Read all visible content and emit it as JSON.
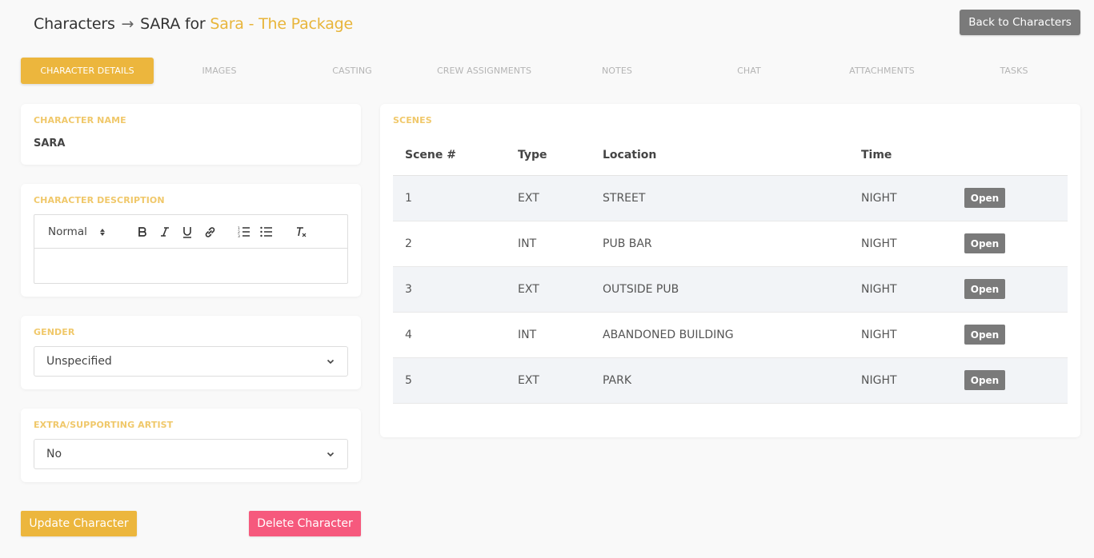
{
  "header": {
    "crumb_root": "Characters",
    "arrow": "→",
    "character": "SARA",
    "for_word": "for",
    "project": "Sara - The Package",
    "back_label": "Back to Characters"
  },
  "tabs": [
    {
      "label": "CHARACTER DETAILS",
      "active": true
    },
    {
      "label": "IMAGES"
    },
    {
      "label": "CASTING"
    },
    {
      "label": "CREW ASSIGNMENTS"
    },
    {
      "label": "NOTES"
    },
    {
      "label": "CHAT"
    },
    {
      "label": "ATTACHMENTS"
    },
    {
      "label": "TASKS"
    }
  ],
  "form": {
    "name_label": "CHARACTER NAME",
    "name_value": "SARA",
    "description_label": "CHARACTER DESCRIPTION",
    "editor_format": "Normal",
    "editor_tools": [
      "bold-icon",
      "italic-icon",
      "underline-icon",
      "link-icon",
      "ordered-list-icon",
      "bullet-list-icon",
      "clear-format-icon"
    ],
    "gender_label": "GENDER",
    "gender_value": "Unspecified",
    "extra_label": "EXTRA/SUPPORTING ARTIST",
    "extra_value": "No",
    "update_label": "Update Character",
    "delete_label": "Delete Character"
  },
  "scenes": {
    "label": "SCENES",
    "columns": [
      "Scene #",
      "Type",
      "Location",
      "Time",
      ""
    ],
    "open_label": "Open",
    "rows": [
      {
        "num": "1",
        "type": "EXT",
        "location": "STREET",
        "time": "NIGHT"
      },
      {
        "num": "2",
        "type": "INT",
        "location": "PUB BAR",
        "time": "NIGHT"
      },
      {
        "num": "3",
        "type": "EXT",
        "location": "OUTSIDE PUB",
        "time": "NIGHT"
      },
      {
        "num": "4",
        "type": "INT",
        "location": "ABANDONED BUILDING",
        "time": "NIGHT"
      },
      {
        "num": "5",
        "type": "EXT",
        "location": "PARK",
        "time": "NIGHT"
      }
    ]
  },
  "colors": {
    "accent": "#ecb63d",
    "danger": "#f6597d",
    "neutral_button": "#7a7a7a"
  }
}
